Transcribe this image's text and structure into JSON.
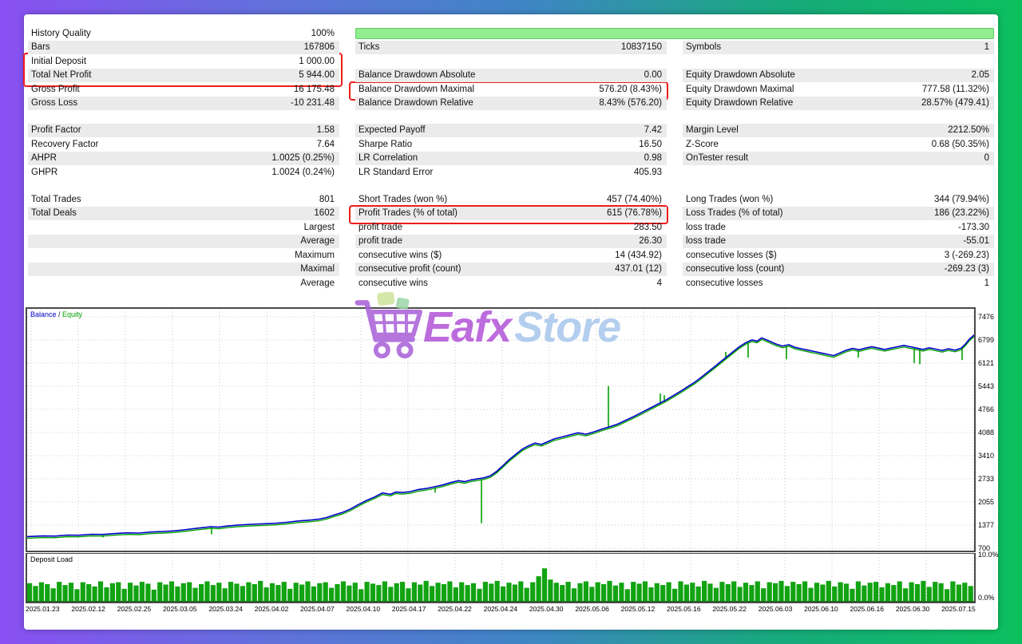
{
  "stats": {
    "rows": [
      {
        "c1l": "History Quality",
        "c1v": "100%",
        "progress": true,
        "stripe": false
      },
      {
        "c1l": "Bars",
        "c1v": "167806",
        "c2l": "Ticks",
        "c2v": "10837150",
        "c3l": "Symbols",
        "c3v": "1",
        "stripe": true
      },
      {
        "c1l": "Initial Deposit",
        "c1v": "1 000.00",
        "stripe": false
      },
      {
        "c1l": "Total Net Profit",
        "c1v": "5 944.00",
        "c2l": "Balance Drawdown Absolute",
        "c2v": "0.00",
        "c3l": "Equity Drawdown Absolute",
        "c3v": "2.05",
        "stripe": true
      },
      {
        "c1l": "Gross Profit",
        "c1v": "16 175.48",
        "c2l": "Balance Drawdown Maximal",
        "c2v": "576.20 (8.43%)",
        "c3l": "Equity Drawdown Maximal",
        "c3v": "777.58 (11.32%)",
        "stripe": false
      },
      {
        "c1l": "Gross Loss",
        "c1v": "-10 231.48",
        "c2l": "Balance Drawdown Relative",
        "c2v": "8.43% (576.20)",
        "c3l": "Equity Drawdown Relative",
        "c3v": "28.57% (479.41)",
        "stripe": true
      },
      {
        "gap": true
      },
      {
        "c1l": "Profit Factor",
        "c1v": "1.58",
        "c2l": "Expected Payoff",
        "c2v": "7.42",
        "c3l": "Margin Level",
        "c3v": "2212.50%",
        "stripe": true
      },
      {
        "c1l": "Recovery Factor",
        "c1v": "7.64",
        "c2l": "Sharpe Ratio",
        "c2v": "16.50",
        "c3l": "Z-Score",
        "c3v": "0.68 (50.35%)",
        "stripe": false
      },
      {
        "c1l": "AHPR",
        "c1v": "1.0025 (0.25%)",
        "c2l": "LR Correlation",
        "c2v": "0.98",
        "c3l": "OnTester result",
        "c3v": "0",
        "stripe": true
      },
      {
        "c1l": "GHPR",
        "c1v": "1.0024 (0.24%)",
        "c2l": "LR Standard Error",
        "c2v": "405.93",
        "stripe": false
      },
      {
        "gap": true
      },
      {
        "c1l": "Total Trades",
        "c1v": "801",
        "c2l": "Short Trades (won %)",
        "c2v": "457 (74.40%)",
        "c3l": "Long Trades (won %)",
        "c3v": "344 (79.94%)",
        "stripe": false
      },
      {
        "c1l": "Total Deals",
        "c1v": "1602",
        "c2l": "Profit Trades (% of total)",
        "c2v": "615 (76.78%)",
        "c3l": "Loss Trades (% of total)",
        "c3v": "186 (23.22%)",
        "stripe": true
      },
      {
        "c1l": "",
        "c1v": "Largest",
        "c2l": "profit trade",
        "c2v": "283.50",
        "c3l": "loss trade",
        "c3v": "-173.30",
        "stripe": false
      },
      {
        "c1l": "",
        "c1v": "Average",
        "c2l": "profit trade",
        "c2v": "26.30",
        "c3l": "loss trade",
        "c3v": "-55.01",
        "stripe": true
      },
      {
        "c1l": "",
        "c1v": "Maximum",
        "c2l": "consecutive wins ($)",
        "c2v": "14 (434.92)",
        "c3l": "consecutive losses ($)",
        "c3v": "3 (-269.23)",
        "stripe": false
      },
      {
        "c1l": "",
        "c1v": "Maximal",
        "c2l": "consecutive profit (count)",
        "c2v": "437.01 (12)",
        "c3l": "consecutive loss (count)",
        "c3v": "-269.23 (3)",
        "stripe": true
      },
      {
        "c1l": "",
        "c1v": "Average",
        "c2l": "consecutive wins",
        "c2v": "4",
        "c3l": "consecutive losses",
        "c3v": "1",
        "stripe": false
      }
    ]
  },
  "chart": {
    "legend": {
      "balance_label": "Balance",
      "separator": " / ",
      "equity_label": "Equity"
    },
    "colors": {
      "balance": "#0000c8",
      "equity": "#00a000",
      "grid": "#c9c9c9"
    },
    "y_min": 700,
    "y_max": 7476,
    "y_labels": [
      7476,
      6799,
      6121,
      5443,
      4766,
      4088,
      3410,
      2733,
      2055,
      1377,
      700
    ],
    "dates": [
      "2025.01.23",
      "2025.02.12",
      "2025.02.25",
      "2025.03.05",
      "2025.03.24",
      "2025.04.02",
      "2025.04.07",
      "2025.04.10",
      "2025.04.17",
      "2025.04.22",
      "2025.04.24",
      "2025.04.30",
      "2025.05.06",
      "2025.05.12",
      "2025.05.16",
      "2025.05.22",
      "2025.06.03",
      "2025.06.10",
      "2025.06.16",
      "2025.06.30",
      "2025.07.15"
    ],
    "balance_points": [
      [
        0,
        1040
      ],
      [
        20,
        1060
      ],
      [
        35,
        1055
      ],
      [
        50,
        1085
      ],
      [
        65,
        1080
      ],
      [
        80,
        1110
      ],
      [
        95,
        1105
      ],
      [
        110,
        1130
      ],
      [
        125,
        1150
      ],
      [
        140,
        1145
      ],
      [
        155,
        1175
      ],
      [
        170,
        1190
      ],
      [
        185,
        1210
      ],
      [
        200,
        1250
      ],
      [
        215,
        1290
      ],
      [
        230,
        1330
      ],
      [
        240,
        1320
      ],
      [
        250,
        1350
      ],
      [
        265,
        1380
      ],
      [
        280,
        1400
      ],
      [
        295,
        1415
      ],
      [
        310,
        1430
      ],
      [
        325,
        1460
      ],
      [
        340,
        1500
      ],
      [
        355,
        1525
      ],
      [
        365,
        1550
      ],
      [
        375,
        1600
      ],
      [
        385,
        1680
      ],
      [
        395,
        1750
      ],
      [
        405,
        1850
      ],
      [
        415,
        1980
      ],
      [
        425,
        2100
      ],
      [
        435,
        2200
      ],
      [
        445,
        2320
      ],
      [
        455,
        2280
      ],
      [
        462,
        2350
      ],
      [
        470,
        2330
      ],
      [
        480,
        2360
      ],
      [
        490,
        2420
      ],
      [
        500,
        2450
      ],
      [
        510,
        2500
      ],
      [
        520,
        2550
      ],
      [
        530,
        2620
      ],
      [
        540,
        2680
      ],
      [
        548,
        2650
      ],
      [
        556,
        2700
      ],
      [
        564,
        2730
      ],
      [
        572,
        2760
      ],
      [
        580,
        2820
      ],
      [
        588,
        2950
      ],
      [
        596,
        3120
      ],
      [
        604,
        3300
      ],
      [
        612,
        3450
      ],
      [
        620,
        3600
      ],
      [
        628,
        3700
      ],
      [
        636,
        3780
      ],
      [
        644,
        3740
      ],
      [
        652,
        3820
      ],
      [
        660,
        3900
      ],
      [
        670,
        3960
      ],
      [
        680,
        4020
      ],
      [
        690,
        4080
      ],
      [
        700,
        4040
      ],
      [
        710,
        4110
      ],
      [
        720,
        4190
      ],
      [
        730,
        4260
      ],
      [
        740,
        4340
      ],
      [
        750,
        4450
      ],
      [
        760,
        4560
      ],
      [
        770,
        4680
      ],
      [
        780,
        4800
      ],
      [
        790,
        4920
      ],
      [
        800,
        5040
      ],
      [
        810,
        5180
      ],
      [
        820,
        5320
      ],
      [
        828,
        5440
      ],
      [
        836,
        5560
      ],
      [
        844,
        5700
      ],
      [
        852,
        5850
      ],
      [
        860,
        6000
      ],
      [
        868,
        6150
      ],
      [
        876,
        6300
      ],
      [
        884,
        6450
      ],
      [
        892,
        6600
      ],
      [
        900,
        6720
      ],
      [
        908,
        6800
      ],
      [
        914,
        6760
      ],
      [
        920,
        6860
      ],
      [
        926,
        6800
      ],
      [
        932,
        6740
      ],
      [
        938,
        6680
      ],
      [
        946,
        6620
      ],
      [
        954,
        6660
      ],
      [
        962,
        6580
      ],
      [
        970,
        6540
      ],
      [
        978,
        6500
      ],
      [
        986,
        6460
      ],
      [
        994,
        6420
      ],
      [
        1002,
        6380
      ],
      [
        1010,
        6340
      ],
      [
        1018,
        6420
      ],
      [
        1026,
        6500
      ],
      [
        1034,
        6550
      ],
      [
        1042,
        6510
      ],
      [
        1050,
        6560
      ],
      [
        1058,
        6600
      ],
      [
        1066,
        6560
      ],
      [
        1074,
        6520
      ],
      [
        1082,
        6560
      ],
      [
        1090,
        6600
      ],
      [
        1098,
        6640
      ],
      [
        1106,
        6600
      ],
      [
        1114,
        6560
      ],
      [
        1122,
        6520
      ],
      [
        1130,
        6570
      ],
      [
        1138,
        6530
      ],
      [
        1146,
        6490
      ],
      [
        1154,
        6540
      ],
      [
        1162,
        6500
      ],
      [
        1170,
        6560
      ],
      [
        1176,
        6700
      ],
      [
        1180,
        6820
      ],
      [
        1183,
        6880
      ],
      [
        1186,
        6944
      ]
    ],
    "equity_spikes": [
      [
        95,
        1020
      ],
      [
        231,
        1110
      ],
      [
        511,
        2330
      ],
      [
        569,
        1430
      ],
      [
        728,
        5450
      ],
      [
        793,
        5230
      ],
      [
        798,
        5180
      ],
      [
        875,
        6450
      ],
      [
        903,
        6280
      ],
      [
        951,
        6230
      ],
      [
        1041,
        6280
      ],
      [
        1111,
        6120
      ],
      [
        1118,
        6090
      ],
      [
        1171,
        6210
      ]
    ]
  },
  "deposit": {
    "label": "Deposit Load",
    "top_label": "10.0%",
    "bottom_label": "0.0%",
    "bar_color": "#12a312",
    "bars": [
      0.4,
      0.34,
      0.42,
      0.38,
      0.29,
      0.43,
      0.36,
      0.41,
      0.27,
      0.42,
      0.38,
      0.33,
      0.44,
      0.31,
      0.4,
      0.42,
      0.28,
      0.41,
      0.35,
      0.43,
      0.39,
      0.26,
      0.42,
      0.37,
      0.44,
      0.33,
      0.4,
      0.42,
      0.3,
      0.38,
      0.44,
      0.36,
      0.41,
      0.29,
      0.43,
      0.39,
      0.34,
      0.42,
      0.38,
      0.45,
      0.31,
      0.4,
      0.36,
      0.43,
      0.28,
      0.41,
      0.37,
      0.44,
      0.33,
      0.4,
      0.42,
      0.3,
      0.38,
      0.44,
      0.35,
      0.41,
      0.27,
      0.43,
      0.39,
      0.36,
      0.44,
      0.32,
      0.4,
      0.43,
      0.29,
      0.42,
      0.37,
      0.45,
      0.34,
      0.41,
      0.38,
      0.44,
      0.31,
      0.42,
      0.36,
      0.4,
      0.28,
      0.43,
      0.39,
      0.45,
      0.33,
      0.41,
      0.37,
      0.44,
      0.3,
      0.42,
      0.55,
      0.72,
      0.48,
      0.41,
      0.36,
      0.43,
      0.29,
      0.4,
      0.44,
      0.32,
      0.42,
      0.38,
      0.45,
      0.35,
      0.41,
      0.27,
      0.43,
      0.39,
      0.44,
      0.31,
      0.4,
      0.36,
      0.42,
      0.28,
      0.44,
      0.37,
      0.41,
      0.33,
      0.45,
      0.39,
      0.3,
      0.43,
      0.38,
      0.44,
      0.32,
      0.41,
      0.36,
      0.44,
      0.29,
      0.42,
      0.4,
      0.45,
      0.34,
      0.43,
      0.38,
      0.44,
      0.3,
      0.41,
      0.37,
      0.45,
      0.33,
      0.42,
      0.39,
      0.28,
      0.44,
      0.35,
      0.41,
      0.43,
      0.31,
      0.4,
      0.36,
      0.44,
      0.29,
      0.42,
      0.38,
      0.45,
      0.32,
      0.43,
      0.4,
      0.27,
      0.44,
      0.37,
      0.41,
      0.34
    ]
  },
  "watermark": {
    "text1": "Eafx",
    "text2": "Store"
  }
}
